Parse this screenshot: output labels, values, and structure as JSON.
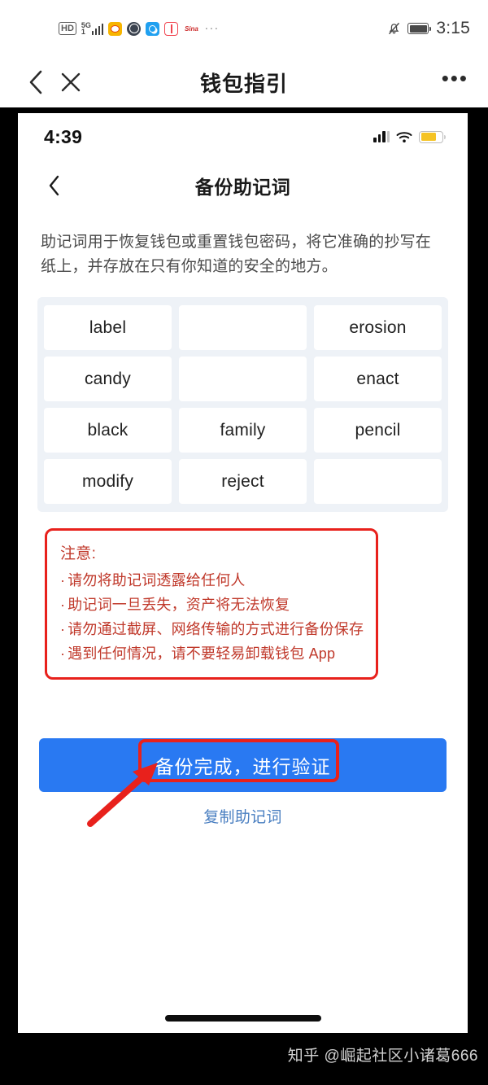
{
  "outer": {
    "status_bar": {
      "hd_label": "HD",
      "network_label": "5G",
      "network_sub": "1",
      "app_icons": [
        {
          "name": "weibo-icon",
          "label": "weibo"
        },
        {
          "name": "globe-icon",
          "label": "globe"
        },
        {
          "name": "search-app-icon",
          "label": "search"
        },
        {
          "name": "book-icon",
          "label": "book"
        },
        {
          "name": "sina-icon",
          "label": "Sina"
        }
      ],
      "overflow": "···",
      "bell_icon": "bell-muted-icon",
      "battery_icon": "battery-full-icon",
      "time": "3:15"
    },
    "nav": {
      "back_icon": "chevron-left-icon",
      "close_icon": "close-icon",
      "title": "钱包指引",
      "more_icon": "more-horizontal-icon",
      "more_label": "•••"
    }
  },
  "inner": {
    "status_bar": {
      "time": "4:39",
      "signal_icon": "cellular-signal-icon",
      "wifi_icon": "wifi-icon",
      "battery_icon": "battery-low-power-icon"
    },
    "nav": {
      "back_icon": "chevron-left-icon",
      "title": "备份助记词"
    },
    "description": "助记词用于恢复钱包或重置钱包密码，将它准确的抄写在纸上，并存放在只有你知道的安全的地方。",
    "mnemonic": {
      "columns": 3,
      "words": [
        "label",
        "",
        "erosion",
        "candy",
        "",
        "enact",
        "black",
        "family",
        "pencil",
        "modify",
        "reject",
        ""
      ]
    },
    "warning": {
      "title": "注意:",
      "bullet": "·",
      "lines": [
        "请勿将助记词透露给任何人",
        "助记词一旦丢失，资产将无法恢复",
        "请勿通过截屏、网络传输的方式进行备份保存",
        "遇到任何情况，请不要轻易卸载钱包 App"
      ]
    },
    "actions": {
      "primary_label": "备份完成，进行验证",
      "copy_label": "复制助记词"
    }
  },
  "annotations": {
    "highlight_rect": "red-highlight-rectangle",
    "arrow": "red-arrow-annotation"
  },
  "watermark": "知乎 @崛起社区小诸葛666",
  "colors": {
    "primary_button": "#2979f2",
    "annotation_red": "#e8211c",
    "warning_text": "#c0392b",
    "link_blue": "#4a7fc1",
    "grid_bg": "#eef2f7",
    "battery_yellow": "#f5c324"
  }
}
